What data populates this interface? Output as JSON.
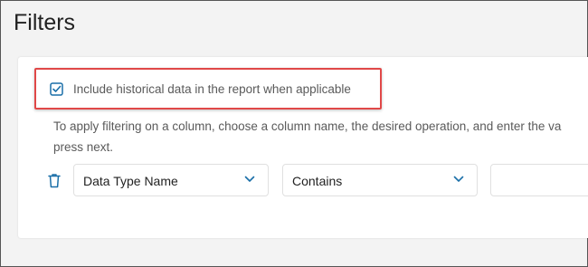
{
  "page": {
    "title": "Filters"
  },
  "historical": {
    "label": "Include historical data in the report when applicable",
    "checked": true,
    "icon": "checkbox-checked-icon"
  },
  "hint": {
    "line1": "To apply filtering on a column, choose a column name, the desired operation, and enter the va",
    "line2": "press next."
  },
  "filter_row": {
    "column_select": {
      "value": "Data Type Name",
      "icon": "chevron-down-icon"
    },
    "operation_select": {
      "value": "Contains",
      "icon": "chevron-down-icon"
    },
    "value_input": {
      "value": "",
      "placeholder": ""
    },
    "delete_icon": "trash-icon"
  },
  "colors": {
    "accent": "#1a6fa8",
    "highlight_border": "#e04848",
    "background": "#f3f3f3"
  }
}
